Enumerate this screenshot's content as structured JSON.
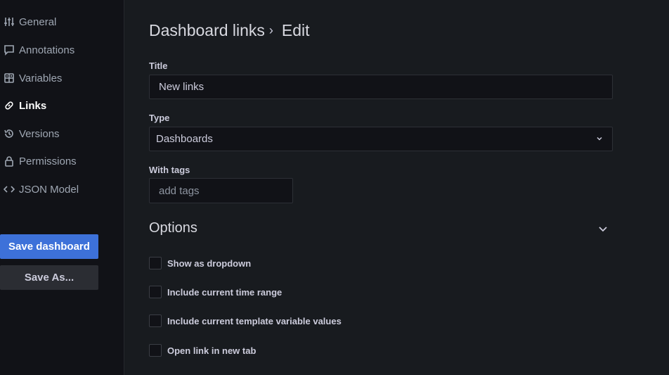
{
  "sidebar": {
    "items": [
      {
        "label": "General",
        "icon": "sliders-icon"
      },
      {
        "label": "Annotations",
        "icon": "comment-icon"
      },
      {
        "label": "Variables",
        "icon": "calculator-icon"
      },
      {
        "label": "Links",
        "icon": "link-icon",
        "active": true
      },
      {
        "label": "Versions",
        "icon": "history-icon"
      },
      {
        "label": "Permissions",
        "icon": "lock-icon"
      },
      {
        "label": "JSON Model",
        "icon": "code-icon"
      }
    ],
    "save_label": "Save dashboard",
    "save_as_label": "Save As..."
  },
  "header": {
    "title": "Dashboard links",
    "separator": "›",
    "subtitle": "Edit"
  },
  "form": {
    "title_label": "Title",
    "title_value": "New links",
    "type_label": "Type",
    "type_value": "Dashboards",
    "tags_label": "With tags",
    "tags_placeholder": "add tags"
  },
  "options": {
    "title": "Options",
    "checkboxes": [
      {
        "label": "Show as dropdown",
        "checked": false
      },
      {
        "label": "Include current time range",
        "checked": false
      },
      {
        "label": "Include current template variable values",
        "checked": false
      },
      {
        "label": "Open link in new tab",
        "checked": false
      }
    ]
  },
  "colors": {
    "background": "#181b1f",
    "sidebar": "#111217",
    "primary": "#3d71d9",
    "secondary": "#2b2d33",
    "input_bg": "#111217"
  }
}
